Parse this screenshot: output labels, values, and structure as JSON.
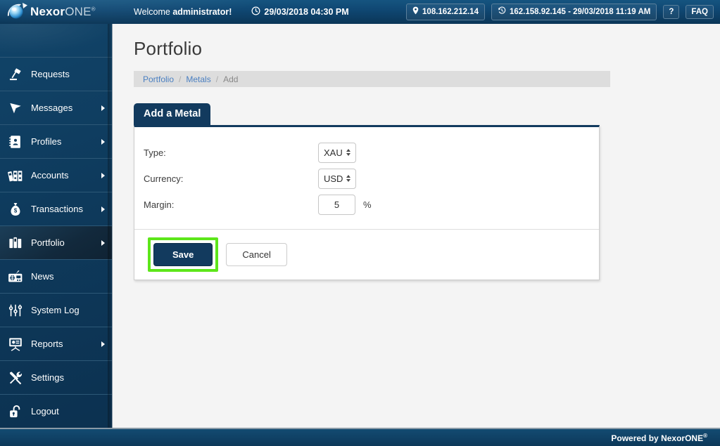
{
  "header": {
    "logo": {
      "brand_bold": "Nexor",
      "brand_light": "ONE",
      "registered": "®",
      "icon": "nexor-sphere-logo"
    },
    "welcome_prefix": "Welcome ",
    "welcome_user": "administrator!",
    "clock_icon": "clock-icon",
    "datetime": "29/03/2018 04:30 PM",
    "ip_pin_icon": "location-pin-icon",
    "ip_address": "108.162.212.14",
    "history_icon": "history-clock-icon",
    "last_login": "162.158.92.145 - 29/03/2018 11:19 AM",
    "help_label": "?",
    "faq_label": "FAQ"
  },
  "sidebar": {
    "items": [
      {
        "label": "Requests",
        "icon": "desk-lamp-icon",
        "has_submenu": false,
        "active": false
      },
      {
        "label": "Messages",
        "icon": "cursor-arrow-icon",
        "has_submenu": true,
        "active": false
      },
      {
        "label": "Profiles",
        "icon": "address-book-icon",
        "has_submenu": true,
        "active": false
      },
      {
        "label": "Accounts",
        "icon": "binders-icon",
        "has_submenu": true,
        "active": false
      },
      {
        "label": "Transactions",
        "icon": "money-bag-icon",
        "has_submenu": true,
        "active": false
      },
      {
        "label": "Portfolio",
        "icon": "briefcase-icon",
        "has_submenu": true,
        "active": true
      },
      {
        "label": "News",
        "icon": "radio-icon",
        "has_submenu": false,
        "active": false
      },
      {
        "label": "System Log",
        "icon": "sliders-icon",
        "has_submenu": false,
        "active": false
      },
      {
        "label": "Reports",
        "icon": "presentation-icon",
        "has_submenu": true,
        "active": false
      },
      {
        "label": "Settings",
        "icon": "tools-icon",
        "has_submenu": false,
        "active": false
      },
      {
        "label": "Logout",
        "icon": "unlock-icon",
        "has_submenu": false,
        "active": false
      }
    ]
  },
  "main": {
    "page_title": "Portfolio",
    "breadcrumb": {
      "item1": "Portfolio",
      "sep1": "/",
      "item2": "Metals",
      "sep2": "/",
      "current": "Add"
    },
    "tab_label": "Add a Metal",
    "form": {
      "type_label": "Type:",
      "type_value": "XAU",
      "currency_label": "Currency:",
      "currency_value": "USD",
      "margin_label": "Margin:",
      "margin_value": "5",
      "margin_unit": "%"
    },
    "actions": {
      "save_label": "Save",
      "cancel_label": "Cancel"
    }
  },
  "footer": {
    "text": "Powered by NexorONE",
    "registered": "®"
  },
  "colors": {
    "brand_navy": "#123a5e",
    "header_blue": "#0d3f63",
    "sidebar_blue": "#0e3a5c",
    "link_blue": "#4a7fc1",
    "highlight_green": "#5de61a",
    "breadcrumb_bg": "#dddddd",
    "page_bg": "#f4f4f4"
  }
}
